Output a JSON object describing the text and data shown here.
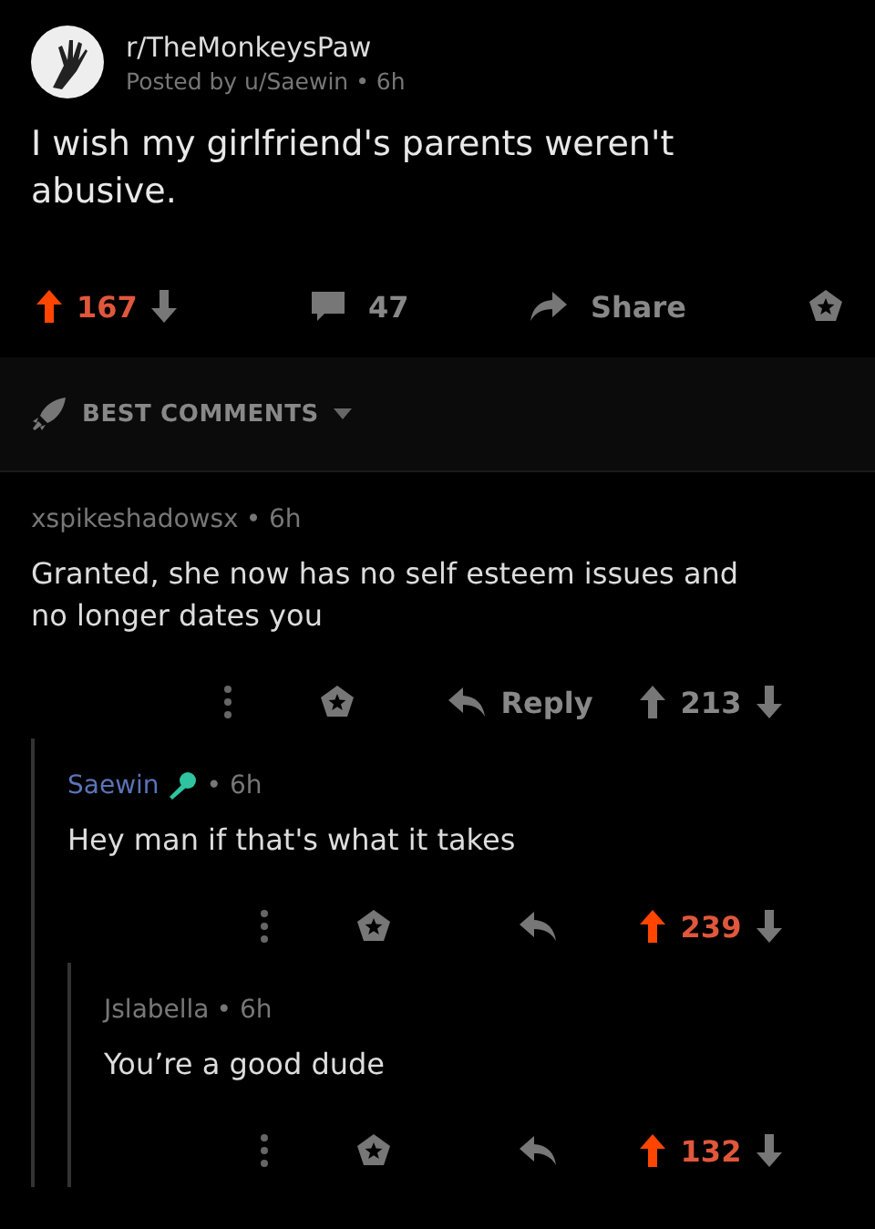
{
  "post": {
    "subreddit": "r/TheMonkeysPaw",
    "meta": "Posted by u/Saewin • 6h",
    "title": "I wish my girlfriend's parents weren't abusive.",
    "upvoted": true,
    "score": "167",
    "comments": "47",
    "share": "Share"
  },
  "sort": {
    "label": "BEST COMMENTS"
  },
  "comments": [
    {
      "author": "xspikeshadowsx",
      "is_op": false,
      "time": "• 6h",
      "body": "Granted, she now has no self esteem issues and no longer dates you",
      "reply": "Reply",
      "upvoted": false,
      "score": "213",
      "children": [
        {
          "author": "Saewin",
          "is_op": true,
          "time": "• 6h",
          "body": "Hey man if that's what it takes",
          "upvoted": true,
          "score": "239",
          "children": [
            {
              "author": "Jslabella",
              "is_op": false,
              "time": "• 6h",
              "body": "You’re a good dude",
              "upvoted": true,
              "score": "132"
            }
          ]
        }
      ]
    }
  ]
}
